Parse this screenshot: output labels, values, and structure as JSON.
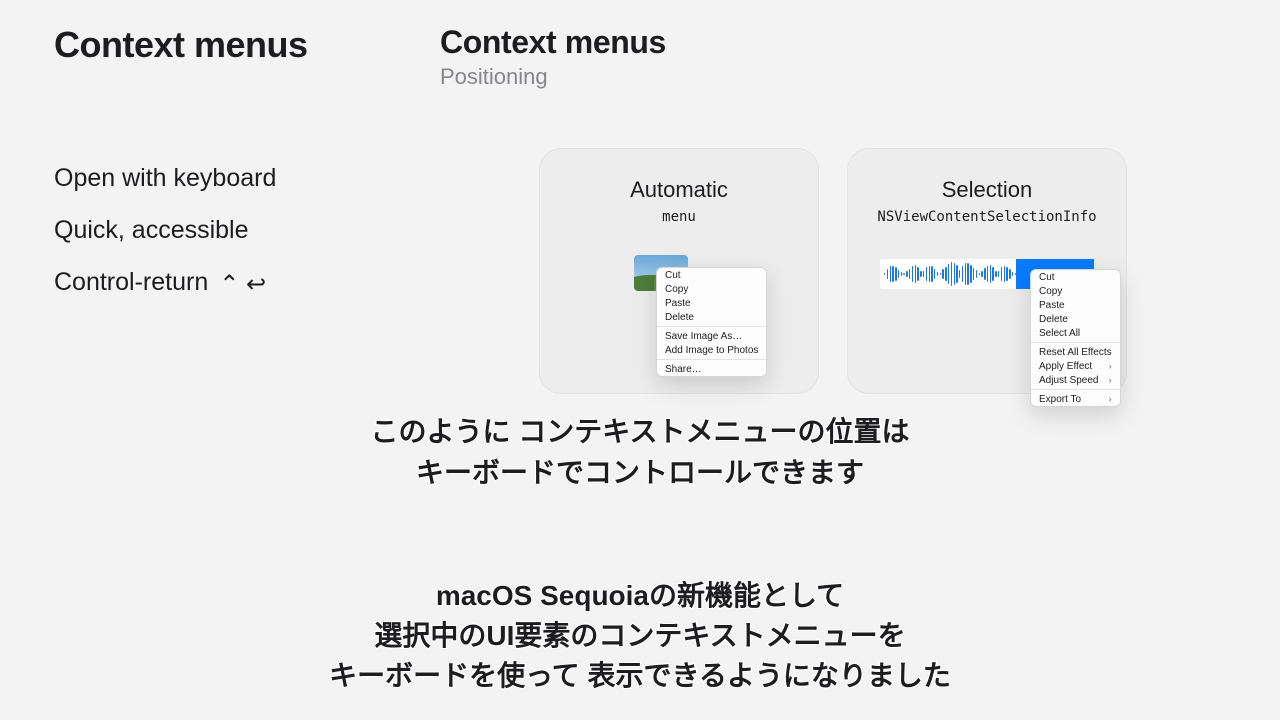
{
  "left": {
    "title": "Context menus",
    "bullets": [
      "Open with keyboard",
      "Quick, accessible",
      "Control-return"
    ],
    "shortcut_glyphs": "⌃ ↩"
  },
  "section": {
    "title": "Context menus",
    "subtitle": "Positioning"
  },
  "cards": {
    "automatic": {
      "title": "Automatic",
      "subtitle": "menu",
      "menu": {
        "cut": "Cut",
        "copy": "Copy",
        "paste": "Paste",
        "delete": "Delete",
        "save_image": "Save Image As…",
        "add_photos": "Add Image to Photos",
        "share": "Share…"
      }
    },
    "selection": {
      "title": "Selection",
      "subtitle": "NSViewContentSelectionInfo",
      "menu": {
        "cut": "Cut",
        "copy": "Copy",
        "paste": "Paste",
        "delete": "Delete",
        "select_all": "Select All",
        "reset_effects": "Reset All Effects",
        "apply_effect": "Apply Effect",
        "adjust_speed": "Adjust Speed",
        "export_to": "Export To"
      }
    }
  },
  "captions": {
    "block1_line1": "このように コンテキストメニューの位置は",
    "block1_line2": "キーボードでコントロールできます",
    "block2_line1": "macOS Sequoiaの新機能として",
    "block2_line2": "選択中のUI要素のコンテキストメニューを",
    "block2_line3": "キーボードを使って 表示できるようになりました"
  }
}
